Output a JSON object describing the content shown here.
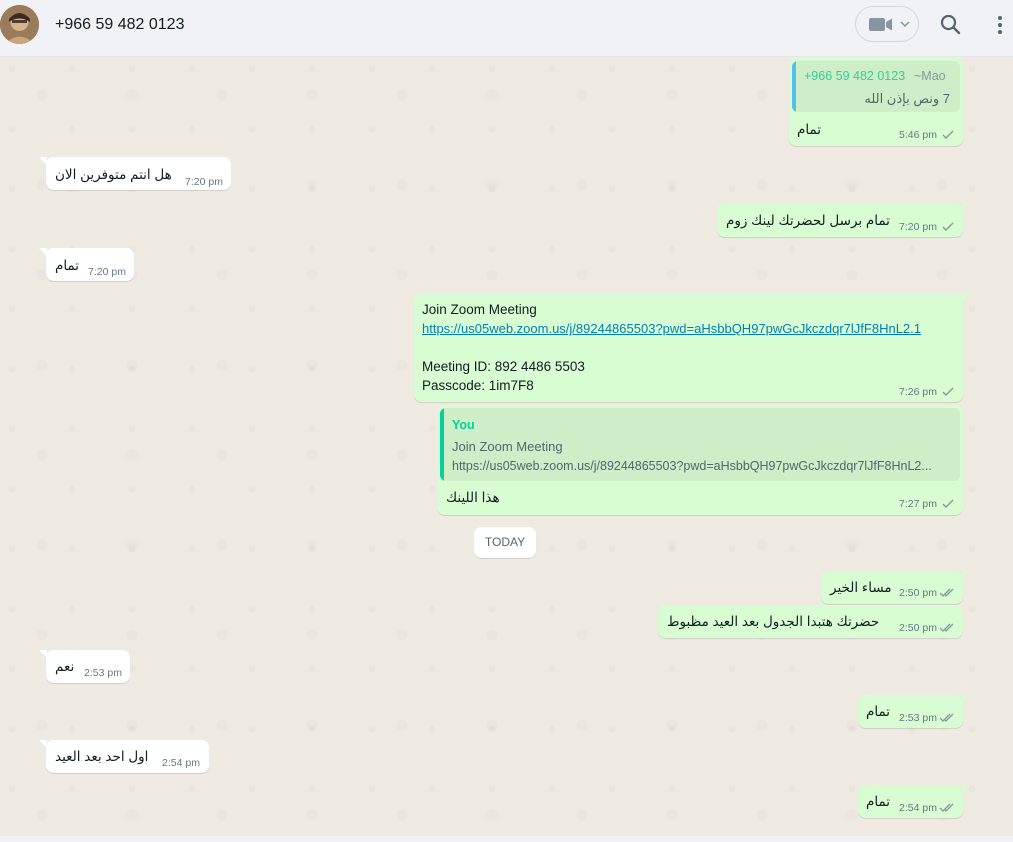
{
  "header": {
    "contact_name": "+966 59 482 0123",
    "avatar_icon": "avatar-photo",
    "video_icon": "video-camera-icon",
    "search_icon": "search-icon",
    "menu_icon": "vertical-dots-menu-icon"
  },
  "colors": {
    "outgoing_bubble": "#d9fdd3",
    "incoming_bubble": "#ffffff",
    "chat_bg": "#efeae2",
    "header_bg": "#f0f2f5",
    "quote_bar_blue": "#53bdeb",
    "quote_bar_green": "#06cf9c",
    "read_tick": "#53bdeb",
    "sent_tick": "#8696a0"
  },
  "messages": {
    "m1": {
      "quote_sender": "+966 59 482 0123",
      "quote_sender_alt": "~Mao",
      "quote_text": "7 ونص بإذن الله",
      "text": "تمام",
      "time": "5:46 pm"
    },
    "m2": {
      "text": "هل انتم متوفرين الان",
      "time": "7:20 pm"
    },
    "m3": {
      "text": "تمام برسل لحضرتك لينك زوم",
      "time": "7:20 pm"
    },
    "m4": {
      "text": "تمام",
      "time": "7:20 pm"
    },
    "m5": {
      "line1": "Join Zoom Meeting",
      "link": "https://us05web.zoom.us/j/89244865503?pwd=aHsbbQH97pwGcJkczdqr7lJfF8HnL2.1",
      "line3": "Meeting ID: 892 4486 5503",
      "line4": "Passcode: 1im7F8",
      "time": "7:26 pm"
    },
    "m6": {
      "quote_sender": "You",
      "quote_line1": "Join Zoom Meeting",
      "quote_line2": "https://us05web.zoom.us/j/89244865503?pwd=aHsbbQH97pwGcJkczdqr7lJfF8HnL2...",
      "text": "هذا اللينك",
      "time": "7:27 pm"
    },
    "day_separator": "TODAY",
    "m7": {
      "text": "مساء الخير",
      "time": "2:50 pm"
    },
    "m8": {
      "text": "حضرتك هتبدا الجدول بعد العيد مظبوط",
      "time": "2:50 pm"
    },
    "m9": {
      "text": "نعم",
      "time": "2:53 pm"
    },
    "m10": {
      "text": "تمام",
      "time": "2:53 pm"
    },
    "m11": {
      "text": "اول احد بعد العيد",
      "time": "2:54 pm"
    },
    "m12": {
      "text": "تمام",
      "time": "2:54 pm"
    }
  }
}
